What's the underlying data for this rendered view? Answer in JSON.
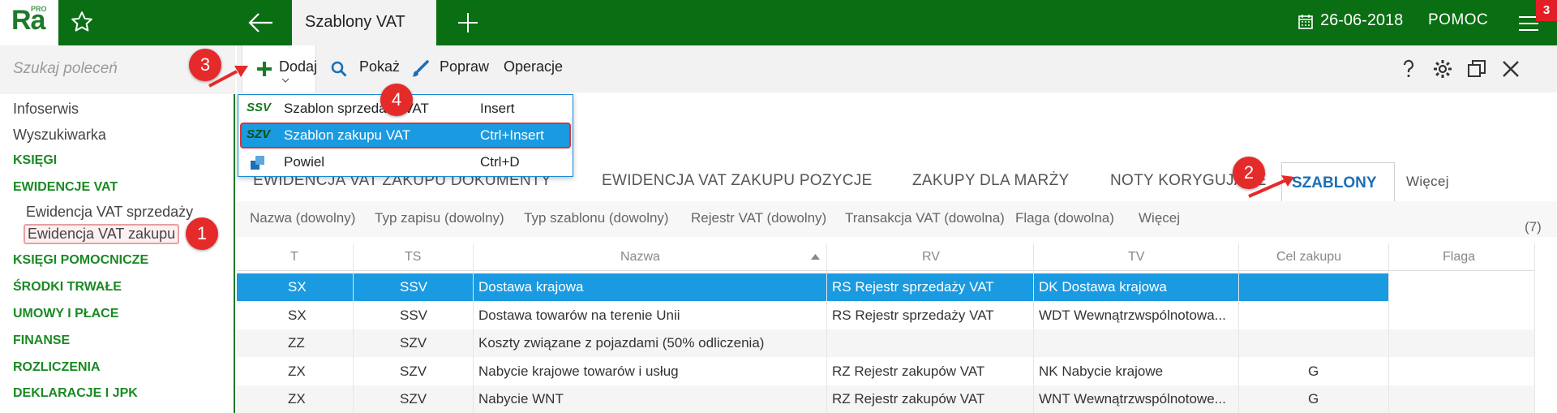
{
  "topbar": {
    "logo_text": "Ra",
    "logo_sup": "PRO",
    "active_tab": "Szablony VAT",
    "date": "26-06-2018",
    "help": "POMOC",
    "badge": "3"
  },
  "sidebar": {
    "search_placeholder": "Szukaj poleceń",
    "items": [
      {
        "label": "Infoserwis",
        "style": "plain"
      },
      {
        "label": "Wyszukiwarka",
        "style": "plain"
      },
      {
        "label": "KSIĘGI",
        "style": "group"
      },
      {
        "label": "EWIDENCJE VAT",
        "style": "group"
      },
      {
        "label": "Ewidencja VAT sprzedaży",
        "style": "sub"
      },
      {
        "label": "Ewidencja VAT zakupu",
        "style": "sub-selected"
      },
      {
        "label": "KSIĘGI POMOCNICZE",
        "style": "group"
      },
      {
        "label": "ŚRODKI TRWAŁE",
        "style": "group"
      },
      {
        "label": "UMOWY I PŁACE",
        "style": "group"
      },
      {
        "label": "FINANSE",
        "style": "group"
      },
      {
        "label": "ROZLICZENIA",
        "style": "group"
      },
      {
        "label": "DEKLARACJE I JPK",
        "style": "group"
      }
    ]
  },
  "toolbar": {
    "add": "Dodaj",
    "show": "Pokaż",
    "edit": "Popraw",
    "operations": "Operacje"
  },
  "dropdown": {
    "items": [
      {
        "code": "SSV",
        "label": "Szablon sprzedaży VAT",
        "shortcut": "Insert"
      },
      {
        "code": "SZV",
        "label": "Szablon zakupu VAT",
        "shortcut": "Ctrl+Insert"
      },
      {
        "code": "",
        "label": "Powiel",
        "shortcut": "Ctrl+D"
      }
    ]
  },
  "tabs": {
    "items": [
      "EWIDENCJA VAT ZAKUPU DOKUMENTY",
      "EWIDENCJA VAT ZAKUPU POZYCJE",
      "ZAKUPY DLA MARŻY",
      "NOTY KORYGUJĄCE",
      "SZABLONY",
      "Więcej"
    ]
  },
  "filters": {
    "items": [
      "Nazwa (dowolny)",
      "Typ zapisu (dowolny)",
      "Typ szablonu (dowolny)",
      "Rejestr VAT (dowolny)",
      "Transakcja VAT (dowolna)",
      "Flaga (dowolna)",
      "Więcej"
    ],
    "count": "(7)"
  },
  "table": {
    "columns": [
      "T",
      "TS",
      "Nazwa",
      "RV",
      "TV",
      "Cel zakupu",
      "Flaga"
    ],
    "rows": [
      {
        "t": "SX",
        "ts": "SSV",
        "nazwa": "Dostawa krajowa",
        "rv": "RS Rejestr sprzedaży VAT",
        "tv": "DK Dostawa krajowa",
        "cel": "",
        "flaga": ""
      },
      {
        "t": "SX",
        "ts": "SSV",
        "nazwa": "Dostawa towarów na terenie Unii",
        "rv": "RS Rejestr sprzedaży VAT",
        "tv": "WDT Wewnątrzwspólnotowa...",
        "cel": "",
        "flaga": ""
      },
      {
        "t": "ZZ",
        "ts": "SZV",
        "nazwa": "Koszty związane z pojazdami (50% odliczenia)",
        "rv": "",
        "tv": "",
        "cel": "",
        "flaga": ""
      },
      {
        "t": "ZX",
        "ts": "SZV",
        "nazwa": "Nabycie krajowe towarów i usług",
        "rv": "RZ Rejestr zakupów VAT",
        "tv": "NK Nabycie krajowe",
        "cel": "G",
        "flaga": ""
      },
      {
        "t": "ZX",
        "ts": "SZV",
        "nazwa": "Nabycie WNT",
        "rv": "RZ Rejestr zakupów VAT",
        "tv": "WNT Wewnątrzwspólnotowe...",
        "cel": "G",
        "flaga": ""
      }
    ]
  },
  "callouts": [
    "1",
    "2",
    "3",
    "4"
  ],
  "colors": {
    "brand_green": "#0a6e12",
    "selection_blue": "#1a9ae0",
    "callout_red": "#e52a2a",
    "active_tab_blue": "#1a6fb8"
  }
}
